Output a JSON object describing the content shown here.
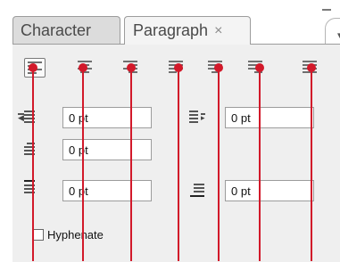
{
  "tabs": [
    {
      "label": "Character",
      "active": false
    },
    {
      "label": "Paragraph",
      "active": true,
      "close_glyph": "×"
    }
  ],
  "panel_controls": {
    "minimize_glyph": "–",
    "menu_glyph": "▾≡"
  },
  "alignment_buttons": [
    {
      "id": "align-left",
      "icon": "align-left-icon",
      "selected": true
    },
    {
      "id": "align-center",
      "icon": "align-center-icon",
      "selected": false
    },
    {
      "id": "align-right",
      "icon": "align-right-icon",
      "selected": false
    },
    {
      "id": "justify-last-left",
      "icon": "justify-last-left-icon",
      "selected": false
    },
    {
      "id": "justify-last-center",
      "icon": "justify-last-center-icon",
      "selected": false
    },
    {
      "id": "justify-last-right",
      "icon": "justify-last-right-icon",
      "selected": false
    },
    {
      "id": "justify-all",
      "icon": "justify-all-icon",
      "selected": false
    }
  ],
  "fields": {
    "indent_left": {
      "value": "0 pt",
      "icon": "left-indent-icon"
    },
    "indent_right": {
      "value": "0 pt",
      "icon": "right-indent-icon"
    },
    "indent_first_line": {
      "value": "0 pt",
      "icon": "first-line-indent-icon"
    },
    "space_before": {
      "value": "0 pt",
      "icon": "space-before-icon"
    },
    "space_after": {
      "value": "0 pt",
      "icon": "space-after-icon"
    }
  },
  "hyphenate": {
    "label": "Hyphenate",
    "checked": false
  },
  "annotation": {
    "marker_color": "#d2192a"
  }
}
